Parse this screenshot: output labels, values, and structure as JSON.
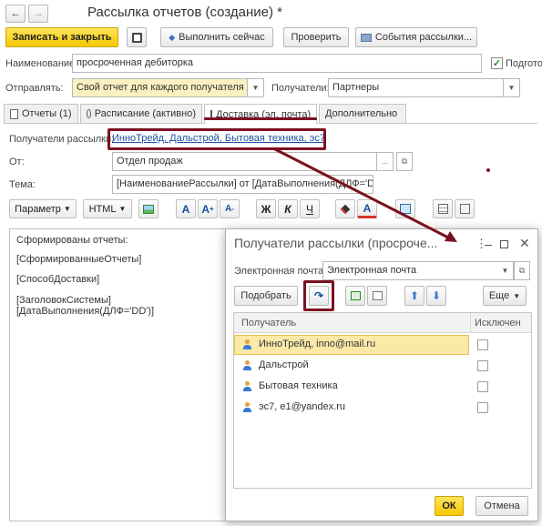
{
  "window": {
    "title": "Рассылка отчетов (создание) *",
    "back_icon": "←",
    "forward_icon": "→",
    "star": "☆",
    "menu": "⋮"
  },
  "toolbar": {
    "save_close": "Записать и закрыть",
    "run_now": "Выполнить сейчас",
    "check": "Проверить",
    "events": "События рассылки..."
  },
  "form": {
    "name_label": "Наименование:",
    "name_value": "просроченная дебиторка",
    "prepare_label": "Подгото",
    "send_label": "Отправлять:",
    "send_value": "Свой отчет для каждого получателя",
    "recipients_label": "Получатели:",
    "recipients_value": "Партнеры"
  },
  "tabs": [
    "Отчеты (1)",
    "Расписание (активно)",
    "Доставка (эл. почта)",
    "Дополнительно"
  ],
  "delivery": {
    "recipients_label": "Получатели рассылки:",
    "recipients_link": "ИнноТрейд, Дальстрой, Бытовая техника, эс7",
    "from_label": "От:",
    "from_value": "Отдел продаж",
    "subject_label": "Тема:",
    "subject_value": "[НаименованиеРассылки] от [ДатаВыполнения(ДЛФ='D')]"
  },
  "editor_toolbar": {
    "param": "Параметр",
    "html": "HTML",
    "bold": "Ж",
    "italic": "К",
    "underline": "Ч",
    "font_a": "A"
  },
  "editor": {
    "lines": [
      "Сформированы отчеты:",
      "[СформированныеОтчеты]",
      "[СпособДоставки]",
      "[ЗаголовокСистемы]",
      "[ДатаВыполнения(ДЛФ='DD')]"
    ]
  },
  "dialog": {
    "title": "Получатели рассылки (просроче...",
    "email_label": "Электронная почта:",
    "email_value": "Электронная почта",
    "pick_button": "Подобрать",
    "more_button": "Еще",
    "col_recipient": "Получатель",
    "col_excluded": "Исключен",
    "rows": [
      {
        "name": "ИнноТрейд, inno@mail.ru"
      },
      {
        "name": "Дальстрой"
      },
      {
        "name": "Бытовая техника"
      },
      {
        "name": "эс7, e1@yandex.ru"
      }
    ],
    "ok": "ОК",
    "cancel": "Отмена"
  },
  "colors": {
    "accent_red": "#7b1020",
    "link": "#1a4fa0",
    "yellow": "#f5c800",
    "selected_row": "#fbe9a8"
  }
}
